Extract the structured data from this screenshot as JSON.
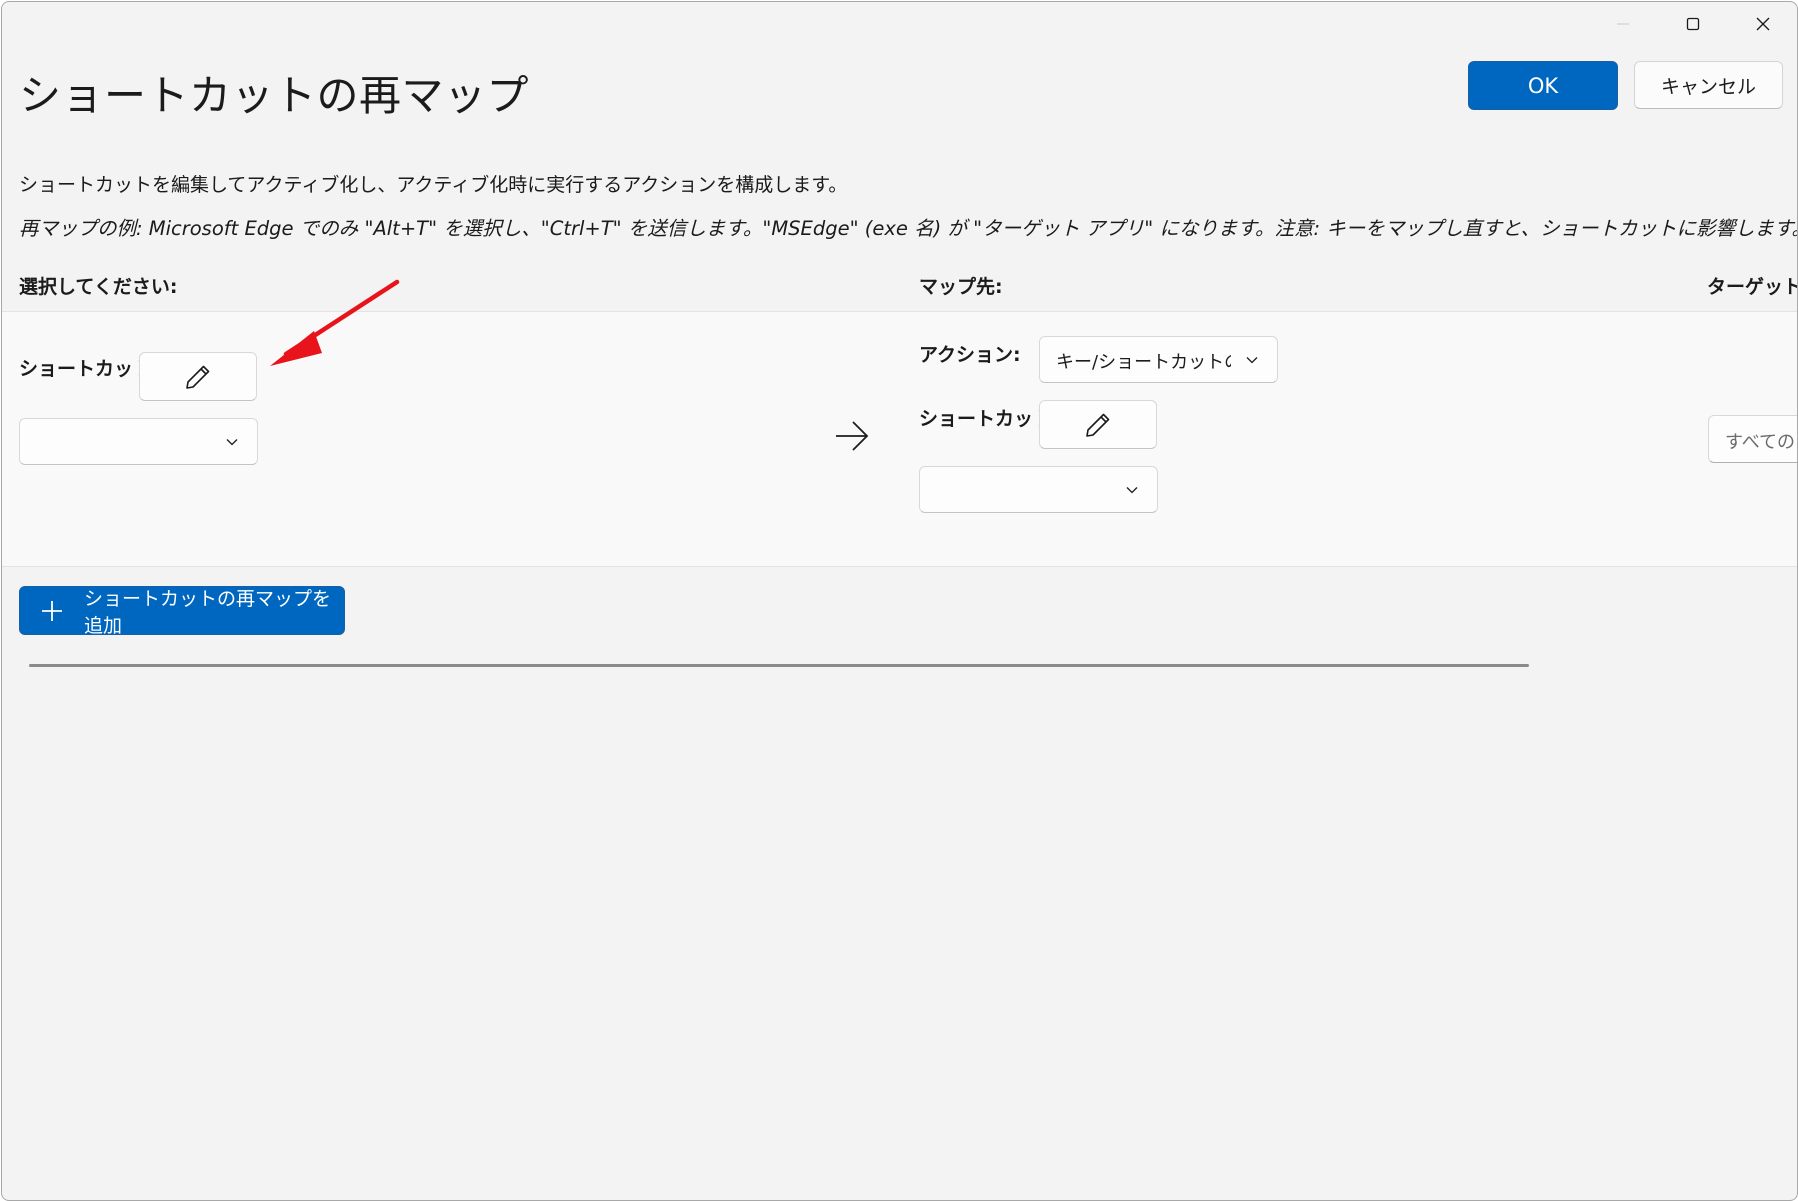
{
  "window": {
    "caption": {
      "minimize_icon": "minimize-icon",
      "maximize_icon": "maximize-icon",
      "close_icon": "close-icon"
    }
  },
  "header": {
    "title": "ショートカットの再マップ",
    "ok_label": "OK",
    "cancel_label": "キャンセル"
  },
  "description": "ショートカットを編集してアクティブ化し、アクティブ化時に実行するアクションを構成します。",
  "example": "再マップの例: Microsoft Edge でのみ \"Alt+T\" を選択し、\"Ctrl+T\" を送信します。\"MSEdge\" (exe 名) が \"ターゲット アプリ\" になります。注意: キーをマップし直すと、ショートカットに影響します。",
  "columns": {
    "select": "選択してください:",
    "map_to": "マップ先:",
    "target_app": "ターゲット ア"
  },
  "row": {
    "source": {
      "shortcut_label": "ショートカット:",
      "edit_icon": "pencil-icon",
      "combo_value": ""
    },
    "arrow_icon": "arrow-right-icon",
    "target": {
      "action_label": "アクション:",
      "action_value": "キー/ショートカットの送",
      "shortcut_label": "ショートカット:",
      "edit_icon": "pencil-icon",
      "combo_value": ""
    },
    "target_app_placeholder": "すべてのア"
  },
  "add_button_label": "ショートカットの再マップを追加",
  "colors": {
    "accent": "#0067c0",
    "annotation": "#e8141b",
    "background": "#f3f3f3",
    "row_background": "#f9f9f9"
  }
}
